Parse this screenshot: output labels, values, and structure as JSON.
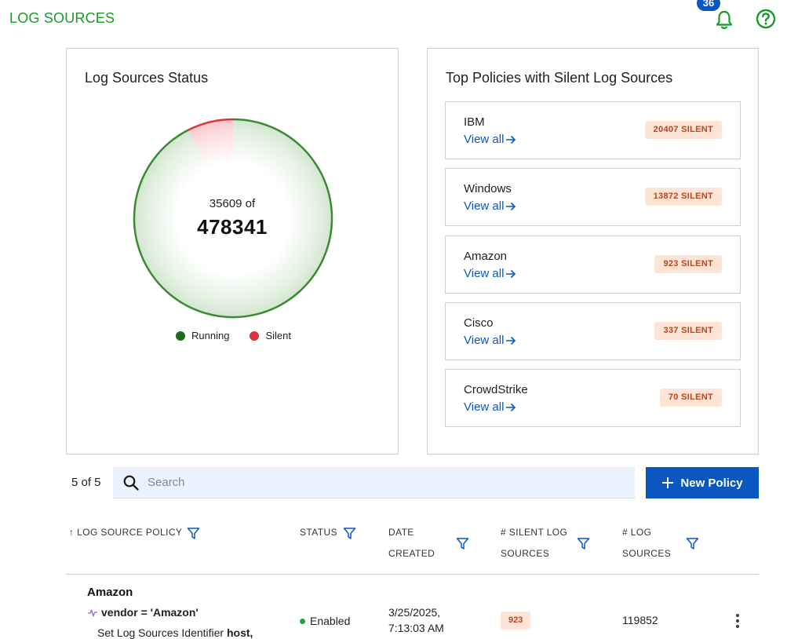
{
  "header": {
    "title": "LOG SOURCES",
    "notification_count": "36",
    "bell_icon": "bell-icon",
    "help_icon": "help-circle-icon"
  },
  "status_card": {
    "title": "Log Sources Status",
    "center_small": "35609 of",
    "center_big": "478341",
    "running_value": 442732,
    "silent_value": 35609,
    "legend": [
      {
        "label": "Running",
        "color": "#1e6b1e"
      },
      {
        "label": "Silent",
        "color": "#e0343c"
      }
    ]
  },
  "policies_card": {
    "title": "Top Policies with Silent Log Sources",
    "view_all_label": "View all",
    "items": [
      {
        "name": "IBM",
        "badge": "20407 SILENT"
      },
      {
        "name": "Windows",
        "badge": "13872 SILENT"
      },
      {
        "name": "Amazon",
        "badge": "923 SILENT"
      },
      {
        "name": "Cisco",
        "badge": "337 SILENT"
      },
      {
        "name": "CrowdStrike",
        "badge": "70 SILENT"
      }
    ]
  },
  "toolbar": {
    "count": "5 of 5",
    "search_placeholder": "Search",
    "search_value": "",
    "new_policy_label": "New Policy"
  },
  "table": {
    "columns": {
      "policy": "LOG SOURCE POLICY",
      "status": "STATUS",
      "date_line1": "DATE",
      "date_line2": "CREATED",
      "silent_line1": "# SILENT LOG",
      "silent_line2": "SOURCES",
      "total_line1": "# LOG",
      "total_line2": "SOURCES"
    },
    "rows": [
      {
        "policy": "Amazon",
        "rule": "vendor = 'Amazon'",
        "desc_prefix": "Set Log Sources Identifier ",
        "desc_bold": "host,",
        "status": "Enabled",
        "date_line1": "3/25/2025,",
        "date_line2": "7:13:03 AM",
        "silent": "923",
        "total": "119852"
      }
    ]
  },
  "colors": {
    "brand_green": "#1a9a2a",
    "accent_blue": "#0a57c2",
    "silent_badge_bg": "#fde4d6",
    "silent_badge_text": "#b8461a",
    "running": "#1e6b1e",
    "silent": "#e0343c",
    "enabled_dot": "#22a33a"
  }
}
